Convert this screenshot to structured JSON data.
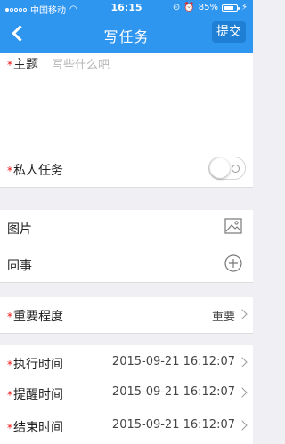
{
  "status_bar": {
    "carrier": "中国移动",
    "time": "16:15",
    "battery": "85%"
  },
  "nav": {
    "title": "写任务",
    "submit_label": "提交"
  },
  "form": {
    "subject": {
      "label": "主题",
      "placeholder": "写些什么吧"
    },
    "private_task": {
      "label": "私人任务",
      "enabled": false
    },
    "image": {
      "label": "图片"
    },
    "colleague": {
      "label": "同事"
    },
    "importance": {
      "label": "重要程度",
      "value": "重要"
    },
    "exec_time": {
      "label": "执行时间",
      "value": "2015-09-21 16:12:07"
    },
    "remind_time": {
      "label": "提醒时间",
      "value": "2015-09-21 16:12:07"
    },
    "end_time": {
      "label": "结束时间",
      "value": "2015-09-21 16:12:07"
    }
  },
  "colors": {
    "accent": "#2f96f0",
    "required": "#ee1111"
  },
  "icons": {
    "back": "chevron-left-icon",
    "image": "image-icon",
    "add": "plus-circle-icon",
    "chevron": "chevron-right-icon"
  }
}
